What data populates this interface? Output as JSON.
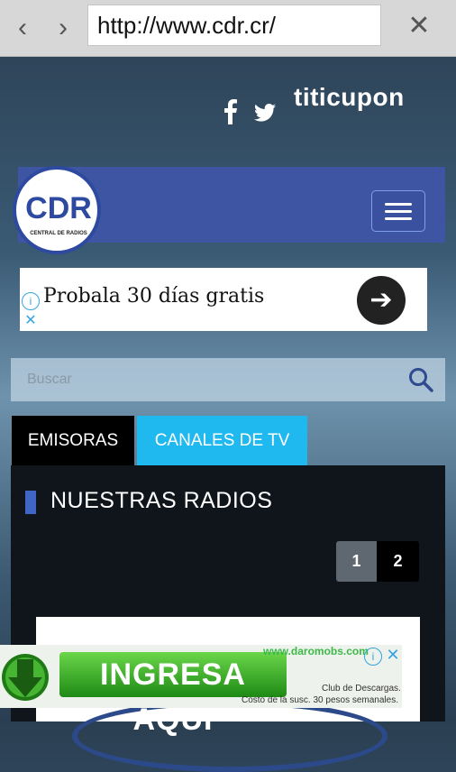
{
  "browser": {
    "back_icon": "chevron-left-icon",
    "forward_icon": "chevron-right-icon",
    "url": "http://www.cdr.cr/",
    "close_icon": "close-icon"
  },
  "social": {
    "facebook_icon": "facebook-icon",
    "twitter_icon": "twitter-icon",
    "partner_logo": "titicupon"
  },
  "header": {
    "logo_text": "CDR",
    "logo_subtitle": "CENTRAL DE RADIOS",
    "brand_color": "#3e55a4",
    "menu_icon": "hamburger-menu-icon"
  },
  "top_ad": {
    "text": "Probala 30 días gratis",
    "arrow_icon": "arrow-right-icon",
    "info_icon": "info-icon",
    "close_icon": "close-icon"
  },
  "search": {
    "placeholder": "Buscar",
    "icon": "search-icon"
  },
  "tabs": [
    {
      "label": "EMISORAS",
      "active": true
    },
    {
      "label": "CANALES DE TV",
      "active": false
    }
  ],
  "section": {
    "title": "NUESTRAS RADIOS",
    "accent": "#3f66c4"
  },
  "pagination": {
    "pages": [
      "1",
      "2"
    ],
    "current": "1"
  },
  "bottom_ad": {
    "button_label": "INGRESA AQUI",
    "site": "www.daromobs.com",
    "line1": "Club de Descargas.",
    "line2": "Costo de la susc. 30 pesos semanales.",
    "download_icon": "download-arrow-icon",
    "info_icon": "info-icon",
    "close_icon": "close-icon"
  }
}
